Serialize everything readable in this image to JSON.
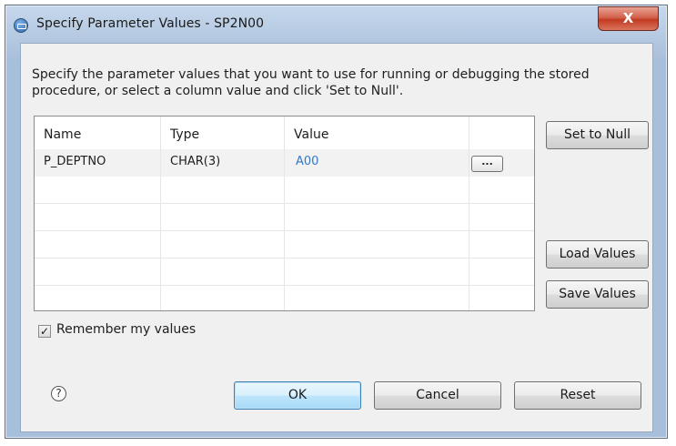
{
  "window": {
    "title": "Specify Parameter Values - SP2N00",
    "close_glyph": "X"
  },
  "description": "Specify the parameter values that you want to use for running or debugging the stored procedure, or select a column value and click 'Set to Null'.",
  "table": {
    "columns": [
      "Name",
      "Type",
      "Value"
    ],
    "rows": [
      {
        "name": "P_DEPTNO",
        "type": "CHAR(3)",
        "value": "A00",
        "browse_label": "..."
      }
    ]
  },
  "buttons": {
    "set_to_null": "Set to Null",
    "load_values": "Load Values",
    "save_values": "Save Values",
    "ok": "OK",
    "cancel": "Cancel",
    "reset": "Reset"
  },
  "remember": {
    "label": "Remember my values",
    "checked": true,
    "check_glyph": "✓"
  },
  "help": {
    "glyph": "?"
  }
}
